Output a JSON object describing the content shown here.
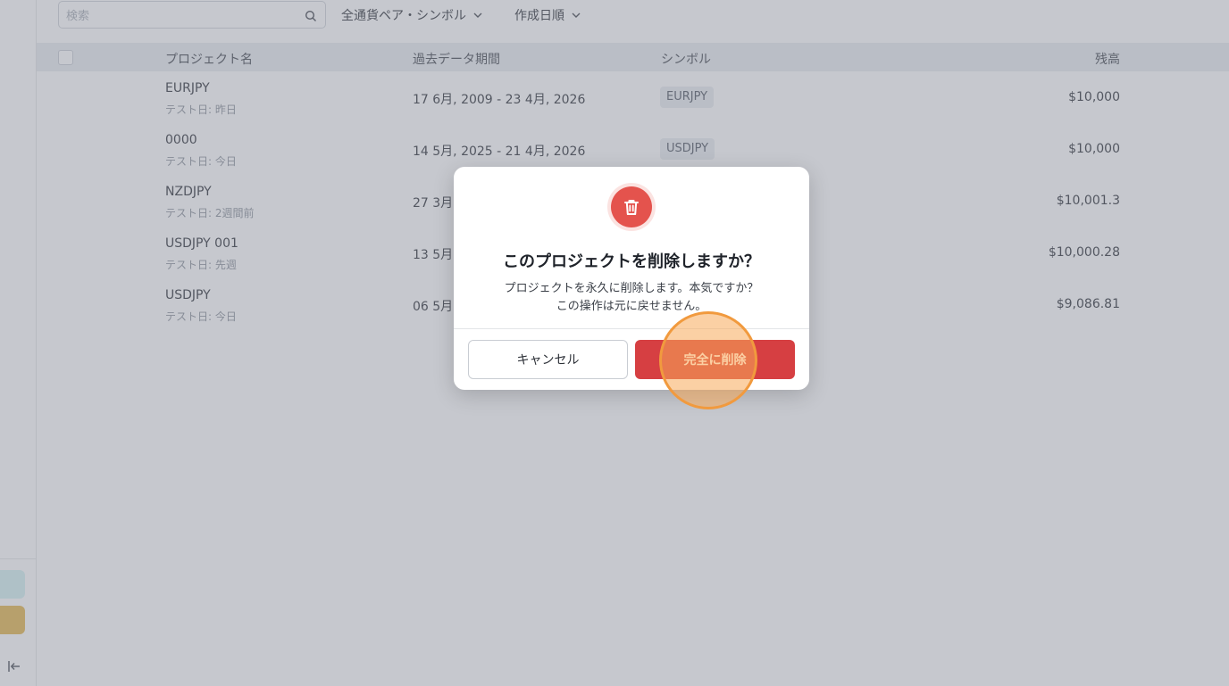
{
  "toolbar": {
    "search_placeholder": "検索",
    "search_value": "",
    "filter_label": "全通貨ペア・シンボル",
    "sort_label": "作成日順"
  },
  "table": {
    "columns": {
      "name": "プロジェクト名",
      "period": "過去データ期間",
      "symbol": "シンボル",
      "balance": "残高"
    },
    "rows": [
      {
        "name": "EURJPY",
        "tested": "テスト日: 昨日",
        "period": "17 6月, 2009 - 23 4月, 2026",
        "symbol": "EURJPY",
        "balance": "$10,000"
      },
      {
        "name": "0000",
        "tested": "テスト日: 今日",
        "period": "14 5月, 2025 - 21 4月, 2026",
        "symbol": "USDJPY",
        "balance": "$10,000"
      },
      {
        "name": "NZDJPY",
        "tested": "テスト日: 2週間前",
        "period": "27 3月,",
        "symbol": "",
        "balance": "$10,001.3"
      },
      {
        "name": "USDJPY 001",
        "tested": "テスト日: 先週",
        "period": "13 5月,",
        "symbol": "",
        "balance": "$10,000.28"
      },
      {
        "name": "USDJPY",
        "tested": "テスト日: 今日",
        "period": "06 5月,",
        "symbol": "",
        "balance": "$9,086.81"
      }
    ]
  },
  "dialog": {
    "title": "このプロジェクトを削除しますか？",
    "message_line1": "プロジェクトを永久に削除します。本気ですか？",
    "message_line2": "この操作は元に戻せません。",
    "cancel_label": "キャンセル",
    "delete_label": "完全に削除",
    "icon": "trash-icon"
  },
  "sidebar": {
    "collapse_icon": "collapse-sidebar-icon"
  },
  "colors": {
    "danger": "#d63f42",
    "highlight": "#f19a3e",
    "header_bg": "#e9ecf1"
  }
}
